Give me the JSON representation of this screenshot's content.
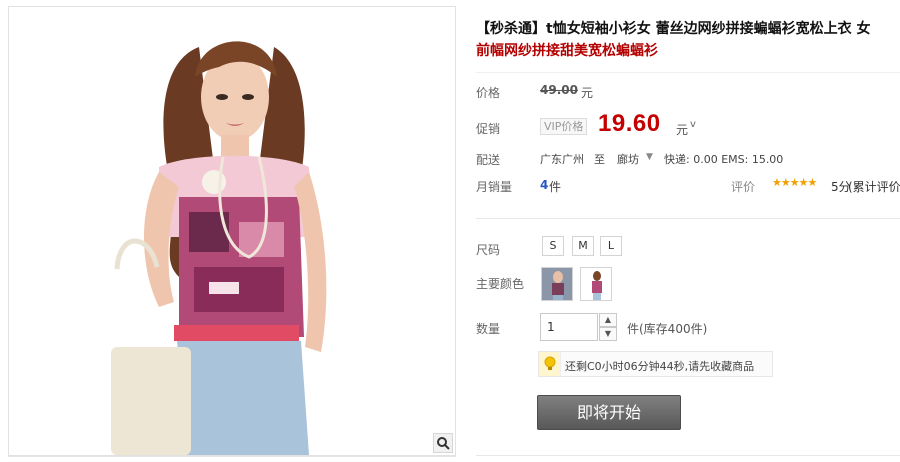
{
  "product": {
    "title": "【秒杀通】t恤女短袖小衫女 蕾丝边网纱拼接蝙蝠衫宽松上衣 女",
    "subtitle": "前幅网纱拼接甜美宽松蝙蝠衫"
  },
  "price": {
    "label": "价格",
    "original": "49.00",
    "unit": "元"
  },
  "promo": {
    "label": "促销",
    "vip_tag": "VIP价格",
    "price": "19.60",
    "unit": "元",
    "dropdown_arrow": "v"
  },
  "shipping": {
    "label": "配送",
    "from": "广东广州",
    "to_label": "至",
    "city": "廊坊",
    "city_arrow": "▼",
    "fees": "快递: 0.00 EMS: 15.00"
  },
  "sales": {
    "label": "月销量",
    "count": "4",
    "unit": "件",
    "rating_label": "评价",
    "stars": "★★★★★",
    "score": "5分",
    "reviews_link": "(累计评价"
  },
  "size": {
    "label": "尺码",
    "options": [
      "S",
      "M",
      "L"
    ]
  },
  "color": {
    "label": "主要颜色"
  },
  "quantity": {
    "label": "数量",
    "value": "1",
    "unit": "件",
    "stock": "(库存400件)"
  },
  "notice": {
    "text": "还剩C0小时06分钟44秒,请先收藏商品"
  },
  "buy_button": {
    "label": "即将开始"
  },
  "colors": {
    "price_red": "#c40000",
    "title_red": "#b40000",
    "button_gray": "#6b6b6b",
    "star_gold": "#f0a000",
    "link_blue": "#2458c2"
  },
  "icons": [
    "zoom-icon",
    "lightbulb-icon",
    "star-icon",
    "chevron-down-icon"
  ]
}
